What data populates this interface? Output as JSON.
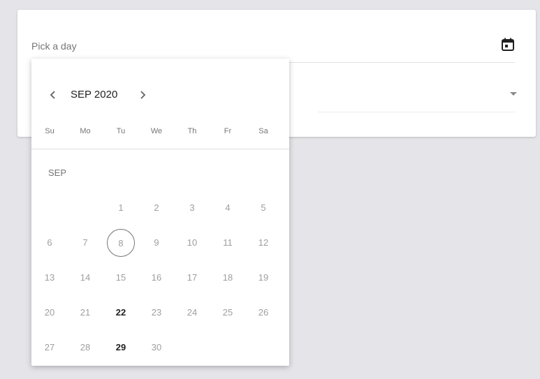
{
  "field": {
    "label": "Pick a day",
    "calendar_icon": "calendar-icon"
  },
  "calendar": {
    "month_title": "SEP 2020",
    "month_label": "SEP",
    "prev_icon": "chevron-left-icon",
    "next_icon": "chevron-right-icon",
    "weekdays": [
      "Su",
      "Mo",
      "Tu",
      "We",
      "Th",
      "Fr",
      "Sa"
    ],
    "first_weekday_index": 2,
    "days": [
      "1",
      "2",
      "3",
      "4",
      "5",
      "6",
      "7",
      "8",
      "9",
      "10",
      "11",
      "12",
      "13",
      "14",
      "15",
      "16",
      "17",
      "18",
      "19",
      "20",
      "21",
      "22",
      "23",
      "24",
      "25",
      "26",
      "27",
      "28",
      "29",
      "30"
    ],
    "today": "8",
    "bold_days": [
      "22",
      "29"
    ]
  },
  "colors": {
    "background": "#e4e4e9",
    "muted_text": "#9e9e9e",
    "strong_text": "#212121"
  }
}
